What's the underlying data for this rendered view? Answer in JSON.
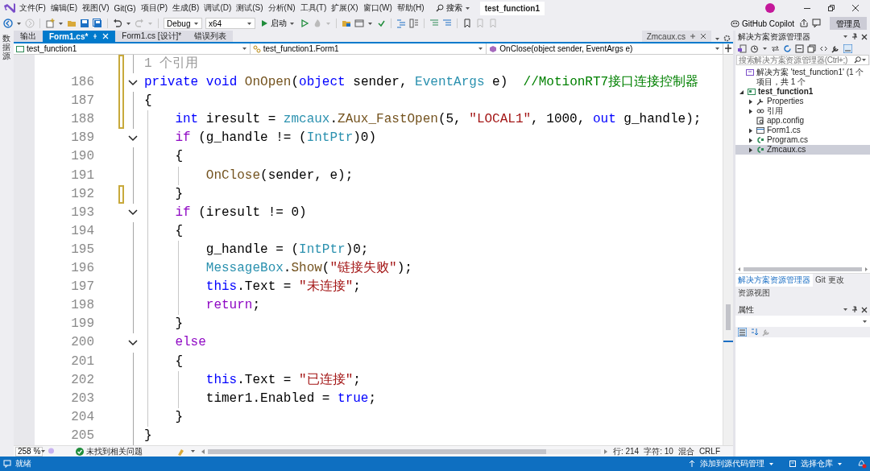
{
  "menu_bar": {
    "items": [
      "文件(F)",
      "编辑(E)",
      "视图(V)",
      "Git(G)",
      "项目(P)",
      "生成(B)",
      "调试(D)",
      "测试(S)",
      "分析(N)",
      "工具(T)",
      "扩展(X)",
      "窗口(W)",
      "帮助(H)"
    ],
    "search": "搜索",
    "solution_title": "test_function1"
  },
  "toolbar": {
    "configuration": "Debug",
    "platform": "x64",
    "start": "启动",
    "copilot": "GitHub Copilot",
    "account": "管理员"
  },
  "side_strip": {
    "tab": "数据源"
  },
  "doc_tabs": [
    {
      "label": "输出",
      "selected": false
    },
    {
      "label": "Form1.cs*",
      "selected": true
    },
    {
      "label": "Form1.cs [设计]*",
      "selected": false
    },
    {
      "label": "错误列表",
      "selected": false
    }
  ],
  "preview_tab": {
    "label": "Zmcaux.cs"
  },
  "nav_bar": [
    "test_function1",
    "test_function1.Form1",
    "OnClose(object sender, EventArgs e)"
  ],
  "editor": {
    "codelens": {
      "text": "1 个引用",
      "changed": true
    },
    "lines": [
      {
        "number": "186",
        "fold": true,
        "changed": true,
        "tokens": [
          {
            "kind": "kw",
            "text": "private"
          },
          {
            "kind": "kw",
            "text": " void"
          },
          {
            "kind": "method",
            "text": " OnOpen"
          },
          {
            "kind": "plain",
            "text": "("
          },
          {
            "kind": "kw",
            "text": "object"
          },
          {
            "kind": "plain",
            "text": " sender, "
          },
          {
            "kind": "type",
            "text": "EventArgs"
          },
          {
            "kind": "plain",
            "text": " e)  "
          },
          {
            "kind": "comment",
            "text": "//MotionRT7接口连接控制器"
          }
        ]
      },
      {
        "number": "187",
        "fold": false,
        "changed": true,
        "tokens": [
          {
            "kind": "plain",
            "text": "{"
          }
        ]
      },
      {
        "number": "188",
        "fold": false,
        "changed": true,
        "tokens": [
          {
            "kind": "kw",
            "text": "    int"
          },
          {
            "kind": "plain",
            "text": " iresult = "
          },
          {
            "kind": "type",
            "text": "zmcaux"
          },
          {
            "kind": "plain",
            "text": "."
          },
          {
            "kind": "method",
            "text": "ZAux_FastOpen"
          },
          {
            "kind": "plain",
            "text": "(5, "
          },
          {
            "kind": "str",
            "text": "\"LOCAL1\""
          },
          {
            "kind": "plain",
            "text": ", 1000, "
          },
          {
            "kind": "kw",
            "text": "out"
          },
          {
            "kind": "plain",
            "text": " g_handle);"
          }
        ]
      },
      {
        "number": "189",
        "fold": true,
        "changed": false,
        "tokens": [
          {
            "kind": "ctl",
            "text": "    if"
          },
          {
            "kind": "plain",
            "text": " (g_handle != ("
          },
          {
            "kind": "type",
            "text": "IntPtr"
          },
          {
            "kind": "plain",
            "text": ")0)"
          }
        ]
      },
      {
        "number": "190",
        "fold": false,
        "changed": false,
        "tokens": [
          {
            "kind": "plain",
            "text": "    {"
          }
        ]
      },
      {
        "number": "191",
        "fold": false,
        "changed": false,
        "tokens": [
          {
            "kind": "method",
            "text": "        OnClose"
          },
          {
            "kind": "plain",
            "text": "(sender, e);"
          }
        ]
      },
      {
        "number": "192",
        "fold": false,
        "changed": true,
        "tokens": [
          {
            "kind": "plain",
            "text": "    }"
          }
        ]
      },
      {
        "number": "193",
        "fold": true,
        "changed": false,
        "tokens": [
          {
            "kind": "ctl",
            "text": "    if"
          },
          {
            "kind": "plain",
            "text": " (iresult != 0)"
          }
        ]
      },
      {
        "number": "194",
        "fold": false,
        "changed": false,
        "tokens": [
          {
            "kind": "plain",
            "text": "    {"
          }
        ]
      },
      {
        "number": "195",
        "fold": false,
        "changed": false,
        "tokens": [
          {
            "kind": "plain",
            "text": "        g_handle = ("
          },
          {
            "kind": "type",
            "text": "IntPtr"
          },
          {
            "kind": "plain",
            "text": ")0;"
          }
        ]
      },
      {
        "number": "196",
        "fold": false,
        "changed": false,
        "tokens": [
          {
            "kind": "type",
            "text": "        MessageBox"
          },
          {
            "kind": "plain",
            "text": "."
          },
          {
            "kind": "method",
            "text": "Show"
          },
          {
            "kind": "plain",
            "text": "("
          },
          {
            "kind": "str",
            "text": "\"链接失败\""
          },
          {
            "kind": "plain",
            "text": ");"
          }
        ]
      },
      {
        "number": "197",
        "fold": false,
        "changed": false,
        "tokens": [
          {
            "kind": "kw",
            "text": "        this"
          },
          {
            "kind": "plain",
            "text": ".Text = "
          },
          {
            "kind": "str",
            "text": "\"未连接\""
          },
          {
            "kind": "plain",
            "text": ";"
          }
        ]
      },
      {
        "number": "198",
        "fold": false,
        "changed": false,
        "tokens": [
          {
            "kind": "ctl",
            "text": "        return"
          },
          {
            "kind": "plain",
            "text": ";"
          }
        ]
      },
      {
        "number": "199",
        "fold": false,
        "changed": false,
        "tokens": [
          {
            "kind": "plain",
            "text": "    }"
          }
        ]
      },
      {
        "number": "200",
        "fold": true,
        "changed": false,
        "tokens": [
          {
            "kind": "ctl",
            "text": "    else"
          }
        ]
      },
      {
        "number": "201",
        "fold": false,
        "changed": false,
        "tokens": [
          {
            "kind": "plain",
            "text": "    {"
          }
        ]
      },
      {
        "number": "202",
        "fold": false,
        "changed": false,
        "tokens": [
          {
            "kind": "kw",
            "text": "        this"
          },
          {
            "kind": "plain",
            "text": ".Text = "
          },
          {
            "kind": "str",
            "text": "\"已连接\""
          },
          {
            "kind": "plain",
            "text": ";"
          }
        ]
      },
      {
        "number": "203",
        "fold": false,
        "changed": false,
        "tokens": [
          {
            "kind": "plain",
            "text": "        timer1.Enabled = "
          },
          {
            "kind": "kw",
            "text": "true"
          },
          {
            "kind": "plain",
            "text": ";"
          }
        ]
      },
      {
        "number": "204",
        "fold": false,
        "changed": false,
        "tokens": [
          {
            "kind": "plain",
            "text": "    }"
          }
        ]
      },
      {
        "number": "205",
        "fold": false,
        "changed": false,
        "tokens": [
          {
            "kind": "plain",
            "text": "}"
          }
        ]
      }
    ]
  },
  "editor_status": {
    "zoom": "258 %",
    "issues": "未找到相关问题",
    "line": "行: 214",
    "column": "字符: 10",
    "mode": "混合",
    "line_ending": "CRLF"
  },
  "solution_explorer": {
    "title": "解决方案资源管理器",
    "search_placeholder": "搜索解决方案资源管理器(Ctrl+;)",
    "tree": [
      {
        "label": "解决方案 'test_function1' (1 个项目，共 1 个",
        "kind": "solution",
        "selected": false,
        "children": [
          {
            "label": "test_function1",
            "kind": "project",
            "expanded": true,
            "selected": false,
            "children": [
              {
                "label": "Properties",
                "kind": "wrench",
                "expanded": false,
                "selected": false
              },
              {
                "label": "引用",
                "kind": "references",
                "expanded": false,
                "selected": false
              },
              {
                "label": "app.config",
                "kind": "config",
                "selected": false
              },
              {
                "label": "Form1.cs",
                "kind": "form",
                "expanded": false,
                "selected": false
              },
              {
                "label": "Program.cs",
                "kind": "csharp",
                "expanded": false,
                "selected": false
              },
              {
                "label": "Zmcaux.cs",
                "kind": "csharp",
                "expanded": false,
                "selected": true
              }
            ]
          }
        ]
      }
    ],
    "tabs": [
      {
        "label": "解决方案资源管理器",
        "selected": true
      },
      {
        "label": "Git 更改",
        "selected": false
      },
      {
        "label": "资源视图",
        "selected": false
      }
    ]
  },
  "properties": {
    "title": "属性"
  },
  "status_bar": {
    "status": "就绪",
    "source_control": "添加到源代码管理",
    "repository": "选择仓库"
  }
}
